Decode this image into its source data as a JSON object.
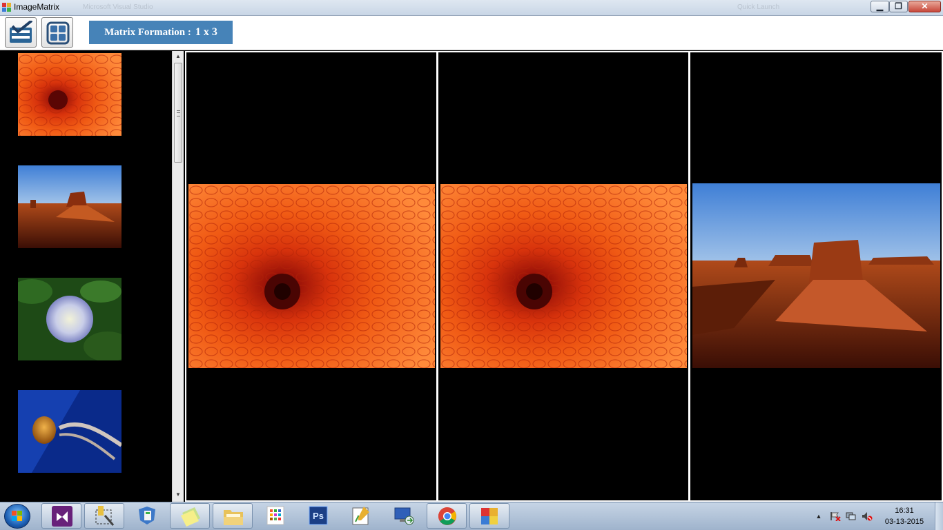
{
  "window": {
    "title": "ImageMatrix",
    "background_title": "Microsoft Visual Studio",
    "background_search": "Quick Launch",
    "buttons": {
      "minimize": "minimize-icon",
      "restore": "restore-icon",
      "close": "close-icon"
    }
  },
  "toolbar": {
    "tools": [
      {
        "name": "select-images-button",
        "icon": "checklist-icon"
      },
      {
        "name": "matrix-layout-button",
        "icon": "grid-icon"
      }
    ],
    "matrix_formation": {
      "label": "Matrix Formation :",
      "value": "1 x 3"
    },
    "label_color": "#4683b8"
  },
  "thumbnails": [
    {
      "name": "chrysanthemum",
      "kind": "flower-orange"
    },
    {
      "name": "desert",
      "kind": "desert"
    },
    {
      "name": "hydrangeas",
      "kind": "hydrangea"
    },
    {
      "name": "jellyfish",
      "kind": "jellyfish"
    }
  ],
  "matrix": {
    "rows": 1,
    "columns": 3,
    "cells": [
      {
        "image": "chrysanthemum"
      },
      {
        "image": "chrysanthemum"
      },
      {
        "image": "desert"
      }
    ]
  },
  "taskbar": {
    "pinned": [
      {
        "name": "visual-studio-icon"
      },
      {
        "name": "selection-tool-icon"
      },
      {
        "name": "shield-app-icon"
      },
      {
        "name": "sticky-notes-icon"
      },
      {
        "name": "file-explorer-icon"
      },
      {
        "name": "metro-app-icon"
      },
      {
        "name": "photoshop-icon",
        "text": "Ps"
      },
      {
        "name": "editor-icon"
      },
      {
        "name": "remote-desktop-icon"
      },
      {
        "name": "chrome-icon"
      },
      {
        "name": "image-matrix-icon"
      }
    ],
    "clock": {
      "time": "16:31",
      "date": "03-13-2015"
    }
  }
}
